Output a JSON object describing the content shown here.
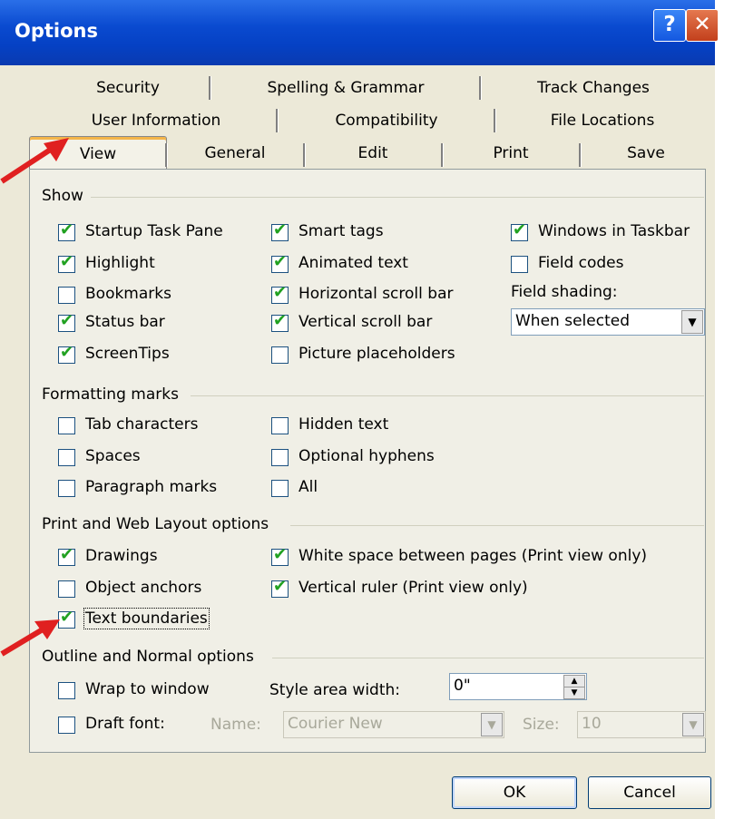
{
  "window": {
    "title": "Options"
  },
  "titlebar": {
    "help_label": "?",
    "close_label": "✕"
  },
  "tabs": {
    "row1": [
      "Security",
      "Spelling & Grammar",
      "Track Changes"
    ],
    "row2": [
      "User Information",
      "Compatibility",
      "File Locations"
    ],
    "row3": [
      "View",
      "General",
      "Edit",
      "Print",
      "Save"
    ],
    "selected": "View"
  },
  "show": {
    "label": "Show",
    "items": [
      {
        "label": "Startup Task Pane",
        "checked": true
      },
      {
        "label": "Highlight",
        "checked": true
      },
      {
        "label": "Bookmarks",
        "checked": false
      },
      {
        "label": "Status bar",
        "checked": true
      },
      {
        "label": "ScreenTips",
        "checked": true
      },
      {
        "label": "Smart tags",
        "checked": true
      },
      {
        "label": "Animated text",
        "checked": true
      },
      {
        "label": "Horizontal scroll bar",
        "checked": true
      },
      {
        "label": "Vertical scroll bar",
        "checked": true
      },
      {
        "label": "Picture placeholders",
        "checked": false
      },
      {
        "label": "Windows in Taskbar",
        "checked": true
      },
      {
        "label": "Field codes",
        "checked": false
      }
    ],
    "field_shading_label": "Field shading:",
    "field_shading_value": "When selected"
  },
  "formatting": {
    "label": "Formatting marks",
    "items": [
      {
        "label": "Tab characters",
        "checked": false
      },
      {
        "label": "Spaces",
        "checked": false
      },
      {
        "label": "Paragraph marks",
        "checked": false
      },
      {
        "label": "Hidden text",
        "checked": false
      },
      {
        "label": "Optional hyphens",
        "checked": false
      },
      {
        "label": "All",
        "checked": false
      }
    ]
  },
  "print_web": {
    "label": "Print and Web Layout options",
    "items": [
      {
        "label": "Drawings",
        "checked": true
      },
      {
        "label": "Object anchors",
        "checked": false
      },
      {
        "label": "Text boundaries",
        "checked": true
      },
      {
        "label": "White space between pages (Print view only)",
        "checked": true
      },
      {
        "label": "Vertical ruler (Print view only)",
        "checked": true
      }
    ]
  },
  "outline": {
    "label": "Outline and Normal options",
    "wrap_label": "Wrap to window",
    "wrap_checked": false,
    "draft_label": "Draft font:",
    "draft_checked": false,
    "style_area_label": "Style area width:",
    "style_area_value": "0\"",
    "name_label": "Name:",
    "name_value": "Courier New",
    "size_label": "Size:",
    "size_value": "10"
  },
  "buttons": {
    "ok": "OK",
    "cancel": "Cancel"
  },
  "colors": {
    "annotation_arrow": "#e02020",
    "title_bar": "#0a4ad0"
  },
  "icons": [
    "help-icon",
    "close-icon",
    "check-icon",
    "dropdown-arrow-icon",
    "spin-up-icon",
    "spin-down-icon",
    "annotation-arrow"
  ]
}
